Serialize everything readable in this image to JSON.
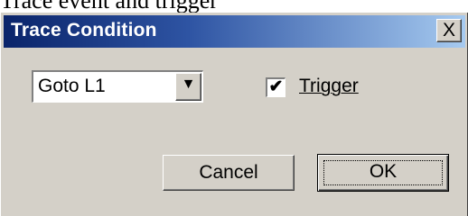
{
  "background_text": "Trace event and trigger",
  "dialog": {
    "title": "Trace Condition",
    "close_label": "X",
    "combo": {
      "value": "Goto L1",
      "arrow": "▼"
    },
    "trigger_checkbox": {
      "checked": true,
      "check_mark": "✔",
      "label": "Trigger"
    },
    "buttons": {
      "cancel": "Cancel",
      "ok": "OK"
    }
  },
  "colors": {
    "dialog_bg": "#d4d0c8",
    "title_gradient_start": "#0a246a",
    "title_gradient_end": "#a6caf0"
  },
  "icons": {
    "close": "close-icon",
    "dropdown": "chevron-down-icon",
    "check": "check-icon"
  }
}
